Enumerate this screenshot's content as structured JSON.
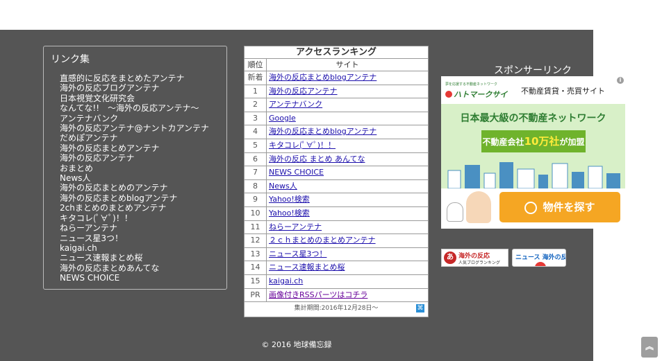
{
  "links": {
    "title": "リンク集",
    "items": [
      "直感的に反応をまとめたアンテナ",
      "海外の反応ブログアンテナ",
      "日本視覚文化研究会",
      "なんてな!!　～海外の反応アンテナ～",
      "アンテナバンク",
      "海外の反応アンテナ@ナントカアンテナ",
      "だめぽアンテナ",
      "海外の反応まとめアンテナ",
      "海外の反応アンテナ",
      "おまとめ",
      "News人",
      "海外の反応まとめのアンテナ",
      "海外の反応まとめblogアンテナ",
      "2chまとめのまとめアンテナ",
      "キタコレ(ﾟ∀ﾟ)！！",
      "ねらーアンテナ",
      "ニュース星3つ！",
      "kaigai.ch",
      "ニュース速報まとめ桜",
      "海外の反応まとめあんてな",
      "NEWS CHOICE"
    ]
  },
  "ranking": {
    "title": "アクセスランキング",
    "col_rank": "順位",
    "col_site": "サイト",
    "rows": [
      {
        "rank": "新着",
        "site": "海外の反応まとめblogアンテナ"
      },
      {
        "rank": "1",
        "site": "海外の反応アンテナ"
      },
      {
        "rank": "2",
        "site": "アンテナバンク"
      },
      {
        "rank": "3",
        "site": "Google"
      },
      {
        "rank": "4",
        "site": "海外の反応まとめblogアンテナ"
      },
      {
        "rank": "5",
        "site": "キタコレ(ﾟ∀ﾟ)！！"
      },
      {
        "rank": "6",
        "site": "海外の反応 まとめ あんてな"
      },
      {
        "rank": "7",
        "site": "NEWS CHOICE"
      },
      {
        "rank": "8",
        "site": "News人"
      },
      {
        "rank": "9",
        "site": "Yahoo!検索"
      },
      {
        "rank": "10",
        "site": "Yahoo!検索"
      },
      {
        "rank": "11",
        "site": "ねらーアンテナ"
      },
      {
        "rank": "12",
        "site": "２ｃｈまとめのまとめアンテナ"
      },
      {
        "rank": "13",
        "site": "ニュース星3つ！"
      },
      {
        "rank": "14",
        "site": "ニュース速報まとめ桜"
      },
      {
        "rank": "15",
        "site": "kaigai.ch"
      },
      {
        "rank": "PR",
        "site": "画像付きRSSパーツはコチラ"
      }
    ],
    "footer": "集計期間:2016年12月28日～"
  },
  "sponsor": {
    "title": "スポンサーリンク",
    "ad": {
      "tagline": "夢を応援する不動産ネットワーク",
      "brand": "ハトマークサイト",
      "service": "不動産賃貸・売買サイト",
      "headline": "日本最大級の不動産ネットワーク",
      "ribbon_pre": "不動産会社",
      "ribbon_num": "10万社",
      "ribbon_post": "が加盟",
      "cta": "物件を探す",
      "info": "i"
    }
  },
  "banners": {
    "b1_line1": "海外の反応",
    "b1_line2": "人気ブログランキング",
    "b2_text": "ニュース 海外の反応"
  },
  "copyright": "© 2016 地球備忘録",
  "colors": {
    "panel_bg": "#555555",
    "link_blue": "#1a0dab",
    "ad_green": "#2e7d32",
    "cta_orange": "#f5a623"
  },
  "icons": {
    "scroll_top": "double-chevron-up-icon",
    "ad_info": "info-icon",
    "ranking_footer": "ranking-logo-icon"
  }
}
